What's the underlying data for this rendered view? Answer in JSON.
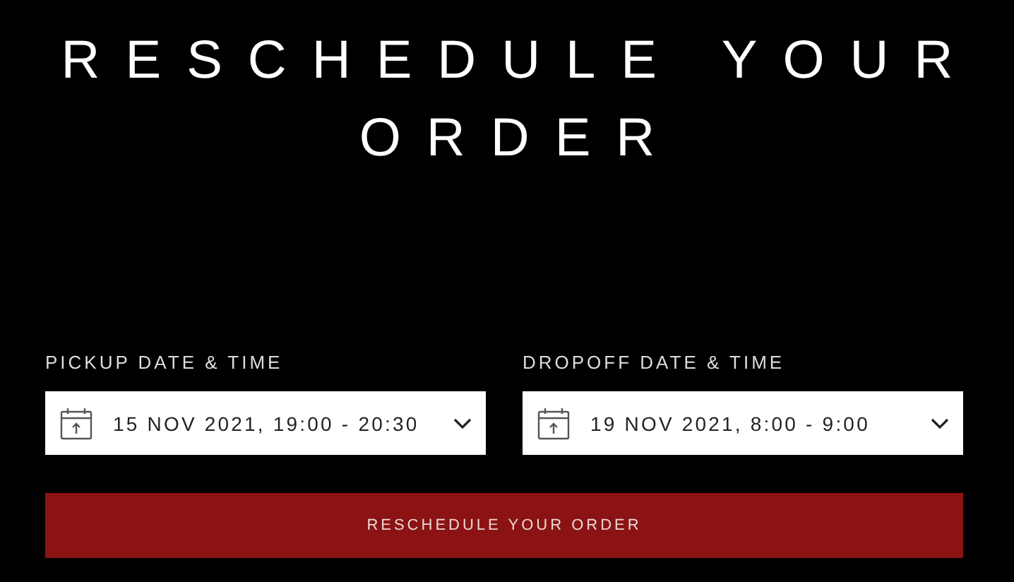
{
  "title": "RESCHEDULE YOUR ORDER",
  "fields": [
    {
      "label": "PICKUP DATE & TIME",
      "value": "15 NOV 2021, 19:00 - 20:30"
    },
    {
      "label": "DROPOFF DATE & TIME",
      "value": "19 NOV 2021, 8:00 - 9:00"
    }
  ],
  "button": "RESCHEDULE YOUR ORDER"
}
